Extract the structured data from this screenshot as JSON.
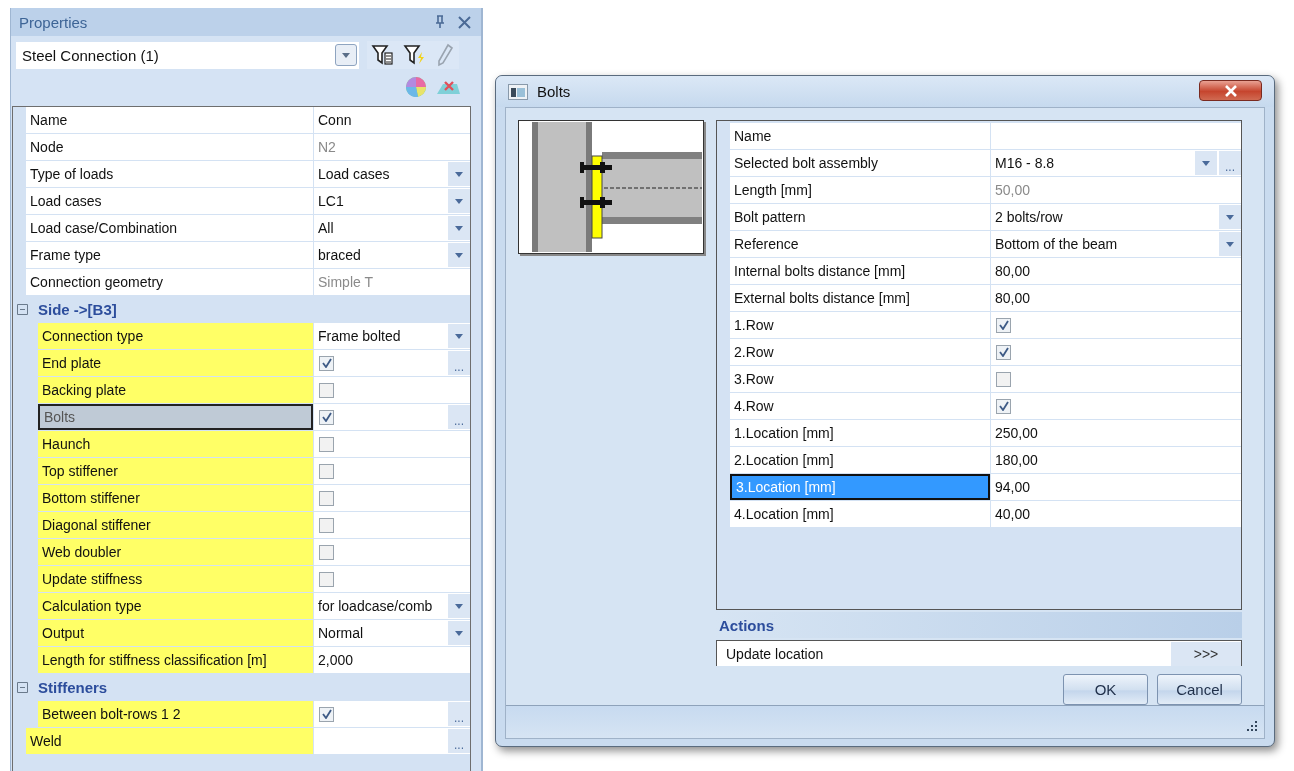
{
  "properties": {
    "title": "Properties",
    "selector": {
      "value": "Steel Connection (1)"
    },
    "rows": [
      {
        "kind": "text",
        "name": "Name",
        "value": "Conn",
        "disabled": false,
        "highlighted": false,
        "selected": false
      },
      {
        "kind": "text",
        "name": "Node",
        "value": "N2",
        "disabled": true,
        "highlighted": false,
        "selected": false
      },
      {
        "kind": "dropdown",
        "name": "Type of loads",
        "value": "Load cases",
        "disabled": false,
        "highlighted": false,
        "selected": false
      },
      {
        "kind": "dropdown",
        "name": "Load cases",
        "value": "LC1",
        "disabled": false,
        "highlighted": false,
        "selected": false
      },
      {
        "kind": "dropdown",
        "name": "Load case/Combination",
        "value": "All",
        "disabled": false,
        "highlighted": false,
        "selected": false
      },
      {
        "kind": "dropdown",
        "name": "Frame type",
        "value": "braced",
        "disabled": false,
        "highlighted": false,
        "selected": false
      },
      {
        "kind": "text",
        "name": "Connection geometry",
        "value": "Simple T",
        "disabled": true,
        "highlighted": false,
        "selected": false
      },
      {
        "kind": "group",
        "name": "Side ->[B3]",
        "expanded": true,
        "children": [
          {
            "kind": "dropdown",
            "name": "Connection type",
            "value": "Frame bolted",
            "disabled": false,
            "highlighted": true,
            "selected": false
          },
          {
            "kind": "checkbox",
            "name": "End plate",
            "checked": true,
            "button": "...",
            "disabled": false,
            "highlighted": true,
            "selected": false
          },
          {
            "kind": "checkbox",
            "name": "Backing plate",
            "checked": false,
            "disabled": false,
            "highlighted": true,
            "selected": false
          },
          {
            "kind": "checkbox",
            "name": "Bolts",
            "checked": true,
            "button": "...",
            "disabled": false,
            "highlighted": true,
            "selected": true
          },
          {
            "kind": "checkbox",
            "name": "Haunch",
            "checked": false,
            "disabled": false,
            "highlighted": true,
            "selected": false
          },
          {
            "kind": "checkbox",
            "name": "Top stiffener",
            "checked": false,
            "disabled": false,
            "highlighted": true,
            "selected": false
          },
          {
            "kind": "checkbox",
            "name": "Bottom stiffener",
            "checked": false,
            "disabled": false,
            "highlighted": true,
            "selected": false
          },
          {
            "kind": "checkbox",
            "name": "Diagonal stiffener",
            "checked": false,
            "disabled": false,
            "highlighted": true,
            "selected": false
          },
          {
            "kind": "checkbox",
            "name": "Web doubler",
            "checked": false,
            "disabled": false,
            "highlighted": true,
            "selected": false
          },
          {
            "kind": "checkbox",
            "name": "Update stiffness",
            "checked": false,
            "disabled": false,
            "highlighted": true,
            "selected": false
          },
          {
            "kind": "dropdown",
            "name": "Calculation type",
            "value": "for loadcase/comb",
            "disabled": false,
            "highlighted": true,
            "selected": false
          },
          {
            "kind": "dropdown",
            "name": "Output",
            "value": "Normal",
            "disabled": false,
            "highlighted": true,
            "selected": false
          },
          {
            "kind": "text",
            "name": "Length for stiffness classification [m]",
            "value": "2,000",
            "disabled": false,
            "highlighted": true,
            "selected": false
          }
        ]
      },
      {
        "kind": "group",
        "name": "Stiffeners",
        "expanded": true,
        "children": [
          {
            "kind": "checkbox",
            "name": "Between bolt-rows 1 2",
            "checked": true,
            "button": "...",
            "disabled": false,
            "highlighted": true,
            "selected": false
          }
        ]
      },
      {
        "kind": "text",
        "name": "Weld",
        "button": "...",
        "highlighted": true,
        "selected": false
      }
    ]
  },
  "dialog": {
    "title": "Bolts",
    "rows": [
      {
        "kind": "text",
        "name": "Name",
        "highlighted": false,
        "selected": false
      },
      {
        "kind": "dropdown",
        "name": "Selected bolt assembly",
        "value": "M16 - 8.8",
        "button": "...",
        "disabled": false,
        "highlighted": false,
        "selected": false
      },
      {
        "kind": "text",
        "name": "Length [mm]",
        "value": "50,00",
        "disabled": true,
        "highlighted": false,
        "selected": false
      },
      {
        "kind": "dropdown",
        "name": "Bolt pattern",
        "value": "2 bolts/row",
        "disabled": false,
        "highlighted": false,
        "selected": false
      },
      {
        "kind": "dropdown",
        "name": "Reference",
        "value": "Bottom of the beam",
        "disabled": false,
        "highlighted": false,
        "selected": false
      },
      {
        "kind": "text",
        "name": "Internal bolts distance [mm]",
        "value": "80,00",
        "disabled": false,
        "highlighted": false,
        "selected": false
      },
      {
        "kind": "text",
        "name": "External bolts distance [mm]",
        "value": "80,00",
        "disabled": false,
        "highlighted": false,
        "selected": false
      },
      {
        "kind": "checkbox",
        "name": "1.Row",
        "checked": true,
        "disabled": false,
        "highlighted": false,
        "selected": false
      },
      {
        "kind": "checkbox",
        "name": "2.Row",
        "checked": true,
        "disabled": false,
        "highlighted": false,
        "selected": false
      },
      {
        "kind": "checkbox",
        "name": "3.Row",
        "checked": false,
        "disabled": false,
        "highlighted": false,
        "selected": false
      },
      {
        "kind": "checkbox",
        "name": "4.Row",
        "checked": true,
        "disabled": false,
        "highlighted": false,
        "selected": false
      },
      {
        "kind": "text",
        "name": "1.Location [mm]",
        "value": "250,00",
        "disabled": false,
        "highlighted": false,
        "selected": false
      },
      {
        "kind": "text",
        "name": "2.Location [mm]",
        "value": "180,00",
        "disabled": false,
        "highlighted": false,
        "selected": false
      },
      {
        "kind": "text",
        "name": "3.Location [mm]",
        "value": "94,00",
        "disabled": false,
        "highlighted": false,
        "selected": true
      },
      {
        "kind": "text",
        "name": "4.Location [mm]",
        "value": "40,00",
        "disabled": false,
        "highlighted": false,
        "selected": false
      }
    ],
    "actions": {
      "title": "Actions",
      "items": [
        {
          "label": "Update location",
          "button": ">>>"
        }
      ]
    },
    "buttons": [
      "OK",
      "Cancel"
    ]
  }
}
